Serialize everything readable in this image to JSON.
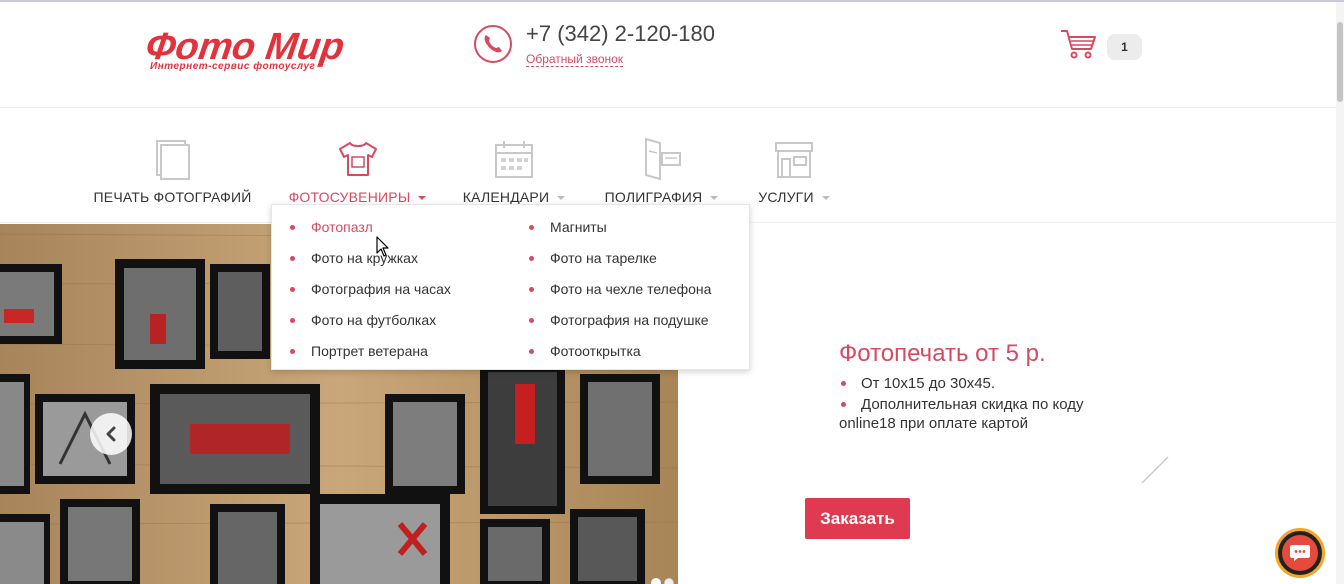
{
  "header": {
    "logo_title": "Фото Мир",
    "logo_subtitle": "Интернет-сервис фотоуслуг",
    "phone": "+7 (342) 2-120-180",
    "callback": "Обратный звонок",
    "cart_count": "1"
  },
  "nav": {
    "items": [
      {
        "label": "ПЕЧАТЬ ФОТОГРАФИЙ",
        "icon": "photos-stack-icon"
      },
      {
        "label": "ФОТОСУВЕНИРЫ",
        "icon": "tshirt-icon"
      },
      {
        "label": "КАЛЕНДАРИ",
        "icon": "calendar-icon"
      },
      {
        "label": "ПОЛИГРАФИЯ",
        "icon": "printing-icon"
      },
      {
        "label": "УСЛУГИ",
        "icon": "shop-icon"
      }
    ]
  },
  "dropdown": {
    "left": [
      "Фотопазл",
      "Фото на кружках",
      "Фотография на часах",
      "Фото на футболках",
      "Портрет ветерана"
    ],
    "right": [
      "Магниты",
      "Фото на тарелке",
      "Фото на чехле телефона",
      "Фотография на подушке",
      "Фотооткрытка"
    ]
  },
  "promo": {
    "title": "Фотопечать от 5 р.",
    "bullets": [
      "От 10x15 до 30x45.",
      "Дополнительная скидка по коду"
    ],
    "continuation": "online18 при оплате картой",
    "order_button": "Заказать"
  },
  "colors": {
    "accent": "#d64a62",
    "brand_red": "#e2323c",
    "button": "#df3a50"
  }
}
